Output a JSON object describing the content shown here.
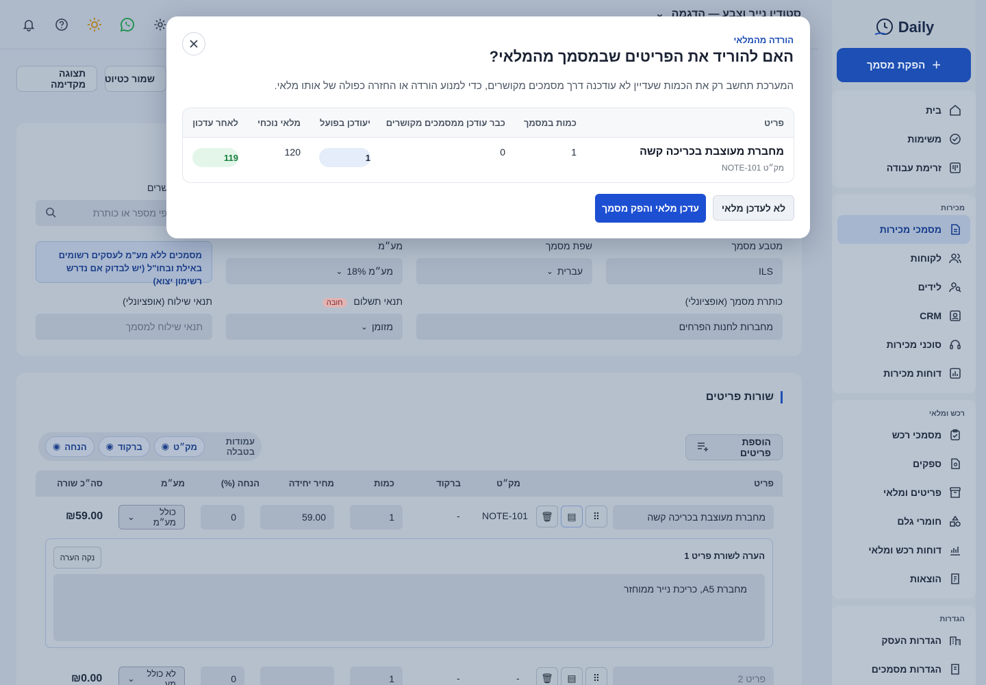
{
  "colors": {
    "primary": "#1d4fd2",
    "accent_text": "#1d4fb4",
    "success": "#16803c",
    "overlay": "#aeb9c9"
  },
  "sidebar": {
    "logo_text": "Daily",
    "cta_label": "הפקת מסמך",
    "groups": [
      {
        "title": "",
        "items": [
          {
            "label": "בית",
            "icon": "home-icon"
          },
          {
            "label": "משימות",
            "icon": "check-circle-icon"
          },
          {
            "label": "זרימת עבודה",
            "icon": "kanban-icon"
          }
        ]
      },
      {
        "title": "מכירות",
        "items": [
          {
            "label": "מסמכי מכירות",
            "icon": "document-icon",
            "active": true
          },
          {
            "label": "לקוחות",
            "icon": "users-icon"
          },
          {
            "label": "לידים",
            "icon": "user-search-icon"
          },
          {
            "label": "CRM",
            "icon": "contact-card-icon"
          },
          {
            "label": "סוכני מכירות",
            "icon": "headset-icon"
          },
          {
            "label": "דוחות מכירות",
            "icon": "bar-chart-icon"
          }
        ]
      },
      {
        "title": "רכש ומלאי",
        "items": [
          {
            "label": "מסמכי רכש",
            "icon": "clipboard-icon"
          },
          {
            "label": "ספקים",
            "icon": "supplier-icon"
          },
          {
            "label": "פריטים ומלאי",
            "icon": "archive-icon"
          },
          {
            "label": "חומרי גלם",
            "icon": "shapes-icon"
          },
          {
            "label": "דוחות רכש ומלאי",
            "icon": "line-chart-icon"
          },
          {
            "label": "הוצאות",
            "icon": "receipt-icon"
          }
        ]
      },
      {
        "title": "הגדרות",
        "items": [
          {
            "label": "הגדרות העסק",
            "icon": "building-icon"
          },
          {
            "label": "הגדרות מסמכים",
            "icon": "doc-settings-icon"
          }
        ]
      }
    ]
  },
  "topbar": {
    "title": "סטודיו נייר וצבע — הדגמה"
  },
  "toolbar": {
    "preview_label": "תצוגה מקדימה",
    "save_draft_label": "שמור כטיוטה"
  },
  "form": {
    "currency_label": "מטבע מסמך",
    "currency_value": "ILS",
    "language_label": "שפת מסמך",
    "language_value": "עברית",
    "vat_label": "מע״מ",
    "vat_value": "מע״מ 18%",
    "notice": "מסמכים ללא מע\"מ לעסקים רשומים באילת ובחו\"ל (יש לבדוק אם נדרש רשימון יצוא)",
    "search_label": "שרים",
    "search_placeholder": "מתאים לפי מספר או כותרת",
    "doc_title_label": "כותרת מסמך (אופציונלי)",
    "doc_title_value": "מחברות לחנות הפרחים",
    "payment_label": "תנאי תשלום",
    "payment_required": "חובה",
    "payment_value": "מזומן",
    "shipping_label": "תנאי שילוח (אופציונלי)",
    "shipping_placeholder": "תנאי שילוח למסמך"
  },
  "items_section": {
    "title": "שורות פריטים",
    "add_button": "הוספת פריטים",
    "columns_label": "עמודות בטבלה",
    "column_pills": [
      "מק״ט",
      "ברקוד",
      "הנחה"
    ],
    "headers": [
      "פריט",
      "מק״ט",
      "ברקוד",
      "כמות",
      "מחיר יחידה",
      "הנחה (%)",
      "מע״מ",
      "סה״כ שורה"
    ],
    "rows": [
      {
        "name": "מחברת מעוצבת בכריכה קשה",
        "sku": "NOTE-101",
        "barcode": "-",
        "qty": "1",
        "price": "59.00",
        "discount": "0",
        "vat": "כולל מע״מ",
        "total": "₪59.00"
      },
      {
        "name": "פריט 2",
        "sku": "-",
        "barcode": "-",
        "qty": "1",
        "price": "",
        "discount": "0",
        "vat": "לא כולל מע",
        "total": "₪0.00"
      }
    ],
    "note": {
      "title": "הערה לשורת פריט 1",
      "clear_label": "נקה הערה",
      "text": "מחברת A5, כריכת נייר ממוחזר"
    }
  },
  "modal": {
    "eyebrow": "הורדה מהמלאי",
    "title": "האם להוריד את הפריטים שבמסמך מהמלאי?",
    "description": "המערכת תחשב רק את הכמות שעדיין לא עודכנה דרך מסמכים מקושרים, כדי למנוע הורדה או החזרה כפולה של אותו מלאי.",
    "headers": {
      "item": "פריט",
      "doc_qty": "כמות במסמך",
      "already_updated": "כבר עודכן ממסמכים מקושרים",
      "to_update": "יעודכן בפועל",
      "current_stock": "מלאי נוכחי",
      "after_update": "לאחר עדכון"
    },
    "row": {
      "name": "מחברת מעוצבת בכריכה קשה",
      "sku": "מק״ט NOTE-101",
      "doc_qty": "1",
      "already_updated": "0",
      "to_update": "1",
      "current_stock": "120",
      "after_update": "119"
    },
    "confirm_label": "עדכן מלאי והפק מסמך",
    "cancel_label": "לא לעדכן מלאי"
  }
}
